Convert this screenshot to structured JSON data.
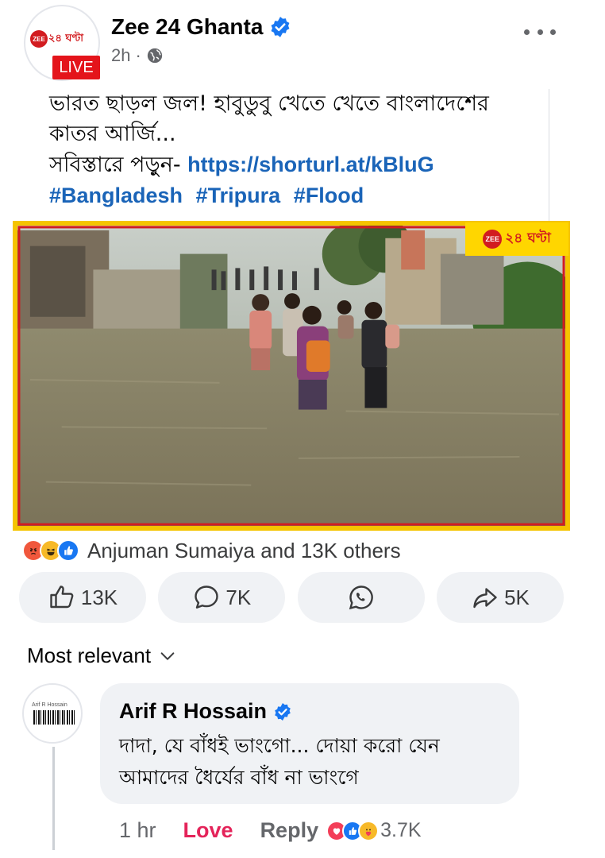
{
  "post": {
    "page_name": "Zee 24 Ghanta",
    "avatar_logo_text": "ZEE",
    "avatar_logo_bengali": "২৪ ঘণ্টা",
    "live_badge": "LIVE",
    "time": "2h",
    "privacy_icon": "globe-icon",
    "text_line1": "ভারত ছাড়ল জল! হাবুডুবু খেতে খেতে বাংলাদেশের",
    "text_line2": "কাতর আর্জি...",
    "text_line3_prefix": "সবিস্তারে পড়ুন- ",
    "link": "https://shorturl.at/kBluG",
    "hashtags": [
      "#Bangladesh",
      "#Tripura",
      "#Flood"
    ],
    "image_logo_text": "ZEE",
    "image_logo_bengali": "২৪ ঘণ্টা"
  },
  "reactions": {
    "icons": [
      "angry-icon",
      "haha-icon",
      "like-icon"
    ],
    "summary": "Anjuman Sumaiya and 13K others"
  },
  "actions": {
    "like_count": "13K",
    "comment_count": "7K",
    "share_count": "5K"
  },
  "comments": {
    "sort_label": "Most relevant",
    "items": [
      {
        "avatar_text": "Arif R Hossain",
        "author": "Arif R Hossain",
        "text_line1": "দাদা, যে বাঁধই ভাংগো... দোয়া করো যেন",
        "text_line2": "আমাদের ধৈর্যের বাঁধ না ভাংগে",
        "time": "1 hr",
        "reaction_label": "Love",
        "reply_label": "Reply",
        "reaction_count": "3.7K"
      }
    ]
  },
  "colors": {
    "link": "#1a64b8",
    "live_badge": "#e4141b",
    "love": "#e4245a",
    "brand_red": "#d21c20",
    "brand_yellow": "#ffd600"
  }
}
